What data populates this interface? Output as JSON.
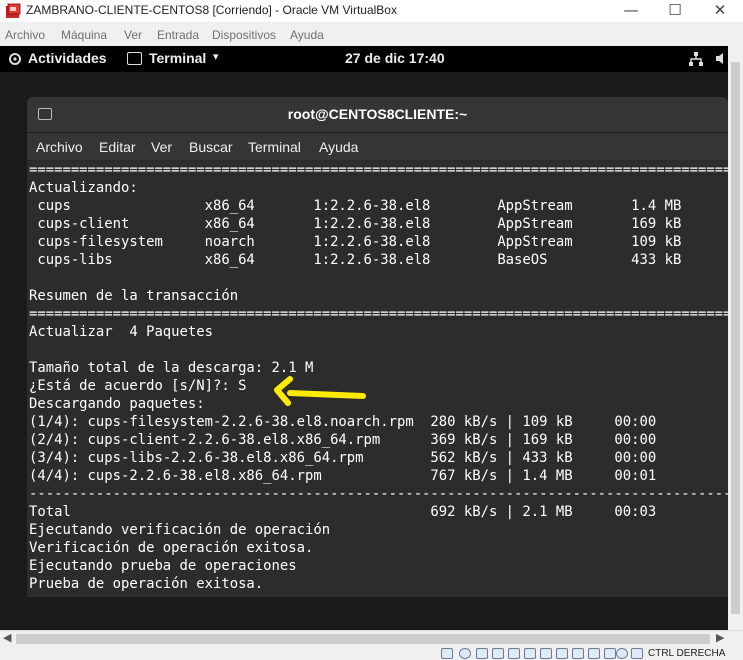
{
  "vbox": {
    "title": "ZAMBRANO-CLIENTE-CENTOS8 [Corriendo] - Oracle VM VirtualBox",
    "window_controls": {
      "minimize": "—",
      "maximize": "☐",
      "close": "✕"
    },
    "menu": [
      "Archivo",
      "Máquina",
      "Ver",
      "Entrada",
      "Dispositivos",
      "Ayuda"
    ],
    "host_key": "CTRL DERECHA"
  },
  "gnome": {
    "activities": "Actividades",
    "app_name": "Terminal",
    "app_arrow": "▾",
    "clock": "27 de dic  17:40"
  },
  "terminal": {
    "title": "root@CENTOS8CLIENTE:~",
    "menu": [
      "Archivo",
      "Editar",
      "Ver",
      "Buscar",
      "Terminal",
      "Ayuda"
    ],
    "lines": [
      "========================================================================================================",
      "Actualizando:",
      " cups                x86_64       1:2.2.6-38.el8        AppStream       1.4 MB",
      " cups-client         x86_64       1:2.2.6-38.el8        AppStream       169 kB",
      " cups-filesystem     noarch       1:2.2.6-38.el8        AppStream       109 kB",
      " cups-libs           x86_64       1:2.2.6-38.el8        BaseOS          433 kB",
      "",
      "Resumen de la transacción",
      "========================================================================================================",
      "Actualizar  4 Paquetes",
      "",
      "Tamaño total de la descarga: 2.1 M",
      "¿Está de acuerdo [s/N]?: S",
      "Descargando paquetes:",
      "(1/4): cups-filesystem-2.2.6-38.el8.noarch.rpm  280 kB/s | 109 kB     00:00",
      "(2/4): cups-client-2.2.6-38.el8.x86_64.rpm      369 kB/s | 169 kB     00:00",
      "(3/4): cups-libs-2.2.6-38.el8.x86_64.rpm        562 kB/s | 433 kB     00:00",
      "(4/4): cups-2.2.6-38.el8.x86_64.rpm             767 kB/s | 1.4 MB     00:01",
      "--------------------------------------------------------------------------------------------------------",
      "Total                                           692 kB/s | 2.1 MB     00:03",
      "Ejecutando verificación de operación",
      "Verificación de operación exitosa.",
      "Ejecutando prueba de operaciones",
      "Prueba de operación exitosa."
    ]
  },
  "colors": {
    "annotation_arrow": "#ffeb00",
    "terminal_bg": "#2c2c2c",
    "terminal_header": "#353535"
  }
}
